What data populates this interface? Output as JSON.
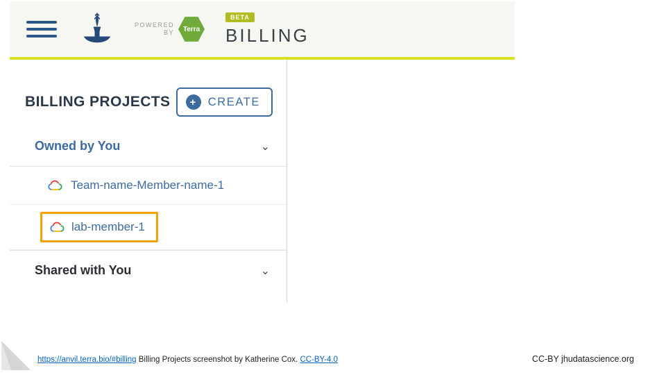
{
  "topbar": {
    "powered_line1": "POWERED",
    "powered_line2": "BY",
    "terra_label": "Terra",
    "beta_label": "BETA",
    "section_title": "BILLING"
  },
  "sidebar": {
    "title": "BILLING PROJECTS",
    "create_label": "CREATE",
    "owned_label": "Owned by You",
    "shared_label": "Shared with You",
    "projects": {
      "0": {
        "name": "Team-name-Member-name-1"
      },
      "1": {
        "name": "lab-member-1"
      }
    }
  },
  "attribution": {
    "url_text": "https://anvil.terra.bio/#billing",
    "middle_text": " Billing Projects screenshot by Katherine Cox.  ",
    "license_text": "CC-BY-4.0"
  },
  "footer_right": "CC-BY  jhudatascience.org"
}
